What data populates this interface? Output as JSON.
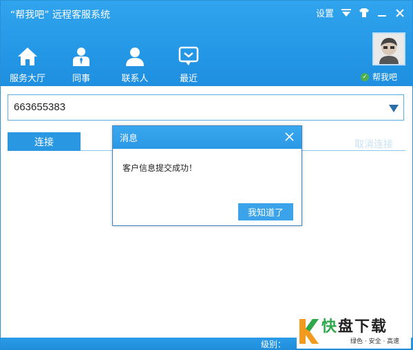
{
  "app": {
    "title": "“帮我吧” 远程客服系统",
    "settings_label": "设置"
  },
  "nav": {
    "items": [
      {
        "label": "服务大厅",
        "icon": "home-icon"
      },
      {
        "label": "同事",
        "icon": "colleague-icon"
      },
      {
        "label": "联系人",
        "icon": "contact-icon"
      },
      {
        "label": "最近",
        "icon": "recent-chat-icon"
      }
    ]
  },
  "user": {
    "name": "帮我吧",
    "status": "online"
  },
  "connect_panel": {
    "id_value": "663655383",
    "connect_label": "连接",
    "cancel_label": "取消连接"
  },
  "dialog": {
    "title": "消息",
    "message": "客户信息提交成功！",
    "ok_label": "我知道了"
  },
  "status_bar": {
    "level_label": "级别："
  },
  "watermark": {
    "main_green": "快",
    "main_rest": "盘下载",
    "tagline": "绿色 · 安全 · 高速"
  },
  "colors": {
    "header_blue": "#2497e6",
    "accent": "#2a97e3",
    "watermark_green": "#2da84a"
  }
}
